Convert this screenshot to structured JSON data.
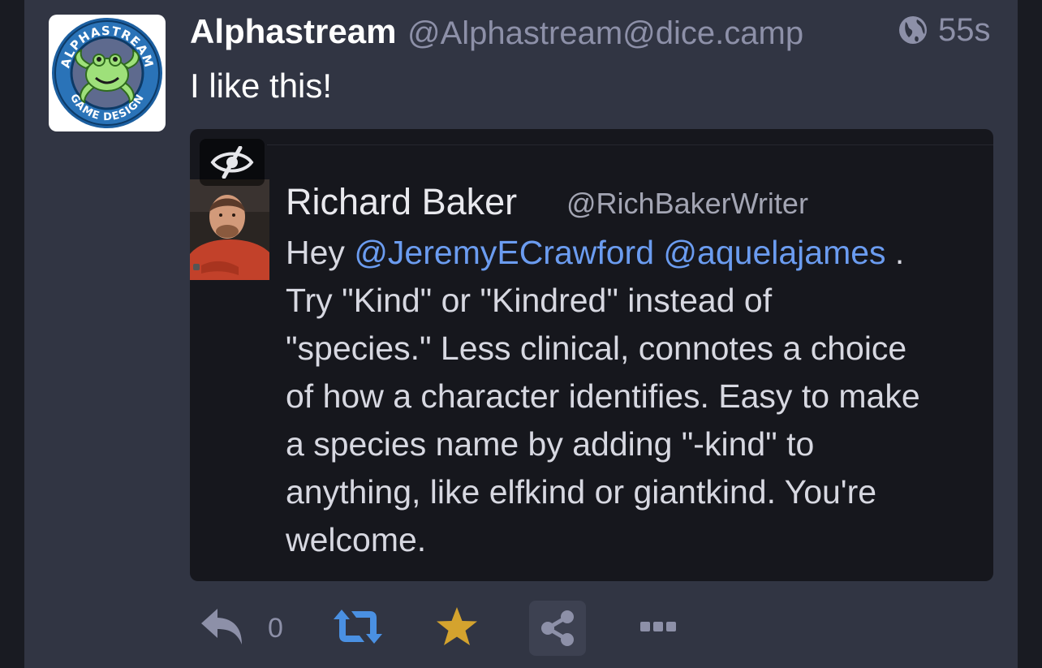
{
  "status": {
    "display_name": "Alphastream",
    "handle": "@Alphastream@dice.camp",
    "visibility_icon": "globe-icon",
    "relative_time": "55s",
    "text": "I like this!",
    "avatar_text_top": "ALPHASTREAM",
    "avatar_text_bottom": "GAME DESIGN"
  },
  "embedded_tweet": {
    "author_name": "Richard Baker",
    "author_handle": "@RichBakerWriter",
    "lines": [
      {
        "before": "Hey ",
        "mention1": "@JeremyECrawford",
        "between": " ",
        "mention2": "@aquelajames",
        "after": " ."
      },
      {
        "text": "Try \"Kind\" or \"Kindred\" instead of"
      },
      {
        "text": "\"species.\" Less clinical, connotes a choice"
      },
      {
        "text": "of how a character identifies. Easy to make"
      },
      {
        "text": "a species name by adding \"-kind\" to"
      },
      {
        "text": "anything, like elfkind or giantkind. You're"
      },
      {
        "text": "welcome."
      }
    ]
  },
  "actions": {
    "reply_count": "0",
    "icons": {
      "reply": "reply-icon",
      "boost": "boost-icon",
      "favourite": "star-icon",
      "share": "share-icon",
      "more": "more-icon",
      "hide_media": "eye-slash-icon"
    }
  },
  "colors": {
    "background": "#191b22",
    "card": "#313543",
    "muted": "#8d90a8",
    "mention": "#6b9cf0",
    "boost": "#4a90e2",
    "favourite": "#d4a32e"
  }
}
